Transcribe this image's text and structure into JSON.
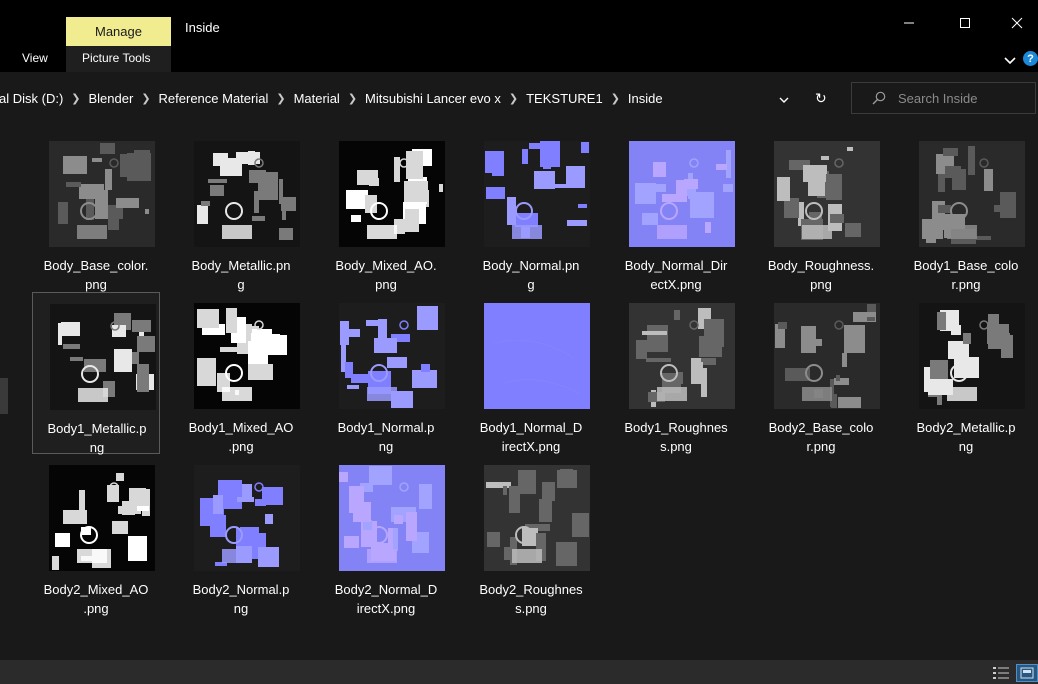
{
  "titlebar": {
    "manage_tab": "Manage",
    "window_title": "Inside",
    "minimize_icon": "minimize-icon",
    "maximize_icon": "maximize-icon",
    "close_icon": "close-icon"
  },
  "ribbon": {
    "view_tab": "View",
    "picture_tools_tab": "Picture Tools",
    "help_label": "?"
  },
  "address": {
    "crumbs": [
      "al Disk (D:)",
      "Blender",
      "Reference Material",
      "Material",
      "Mitsubishi Lancer evo x",
      "TEKSTURE1",
      "Inside"
    ],
    "refresh_glyph": "↻"
  },
  "search": {
    "placeholder": "Search Inside"
  },
  "files": [
    {
      "name": "Body_Base_color.\npng",
      "style": "basecolor"
    },
    {
      "name": "Body_Metallic.pn\ng",
      "style": "metallic"
    },
    {
      "name": "Body_Mixed_AO.\npng",
      "style": "ao"
    },
    {
      "name": "Body_Normal.pn\ng",
      "style": "normal"
    },
    {
      "name": "Body_Normal_Dir\nectX.png",
      "style": "normaldx"
    },
    {
      "name": "Body_Roughness.\npng",
      "style": "roughness"
    },
    {
      "name": "Body1_Base_colo\nr.png",
      "style": "basecolor"
    },
    {
      "name": "Body1_Metallic.p\nng",
      "style": "metallic",
      "selected": true
    },
    {
      "name": "Body1_Mixed_AO\n.png",
      "style": "ao"
    },
    {
      "name": "Body1_Normal.p\nng",
      "style": "normal"
    },
    {
      "name": "Body1_Normal_D\nirectX.png",
      "style": "flatnormal"
    },
    {
      "name": "Body1_Roughnes\ns.png",
      "style": "roughness"
    },
    {
      "name": "Body2_Base_colo\nr.png",
      "style": "basecolor"
    },
    {
      "name": "Body2_Metallic.p\nng",
      "style": "metallic"
    },
    {
      "name": "Body2_Mixed_AO\n.png",
      "style": "ao"
    },
    {
      "name": "Body2_Normal.p\nng",
      "style": "normal"
    },
    {
      "name": "Body2_Normal_D\nirectX.png",
      "style": "normaldx"
    },
    {
      "name": "Body2_Roughnes\ns.png",
      "style": "roughness"
    }
  ],
  "colors": {
    "manage_accent": "#f1ec8f",
    "background": "#191919",
    "normal_map": "#7f7fff",
    "view_selected": "#2a5780"
  }
}
